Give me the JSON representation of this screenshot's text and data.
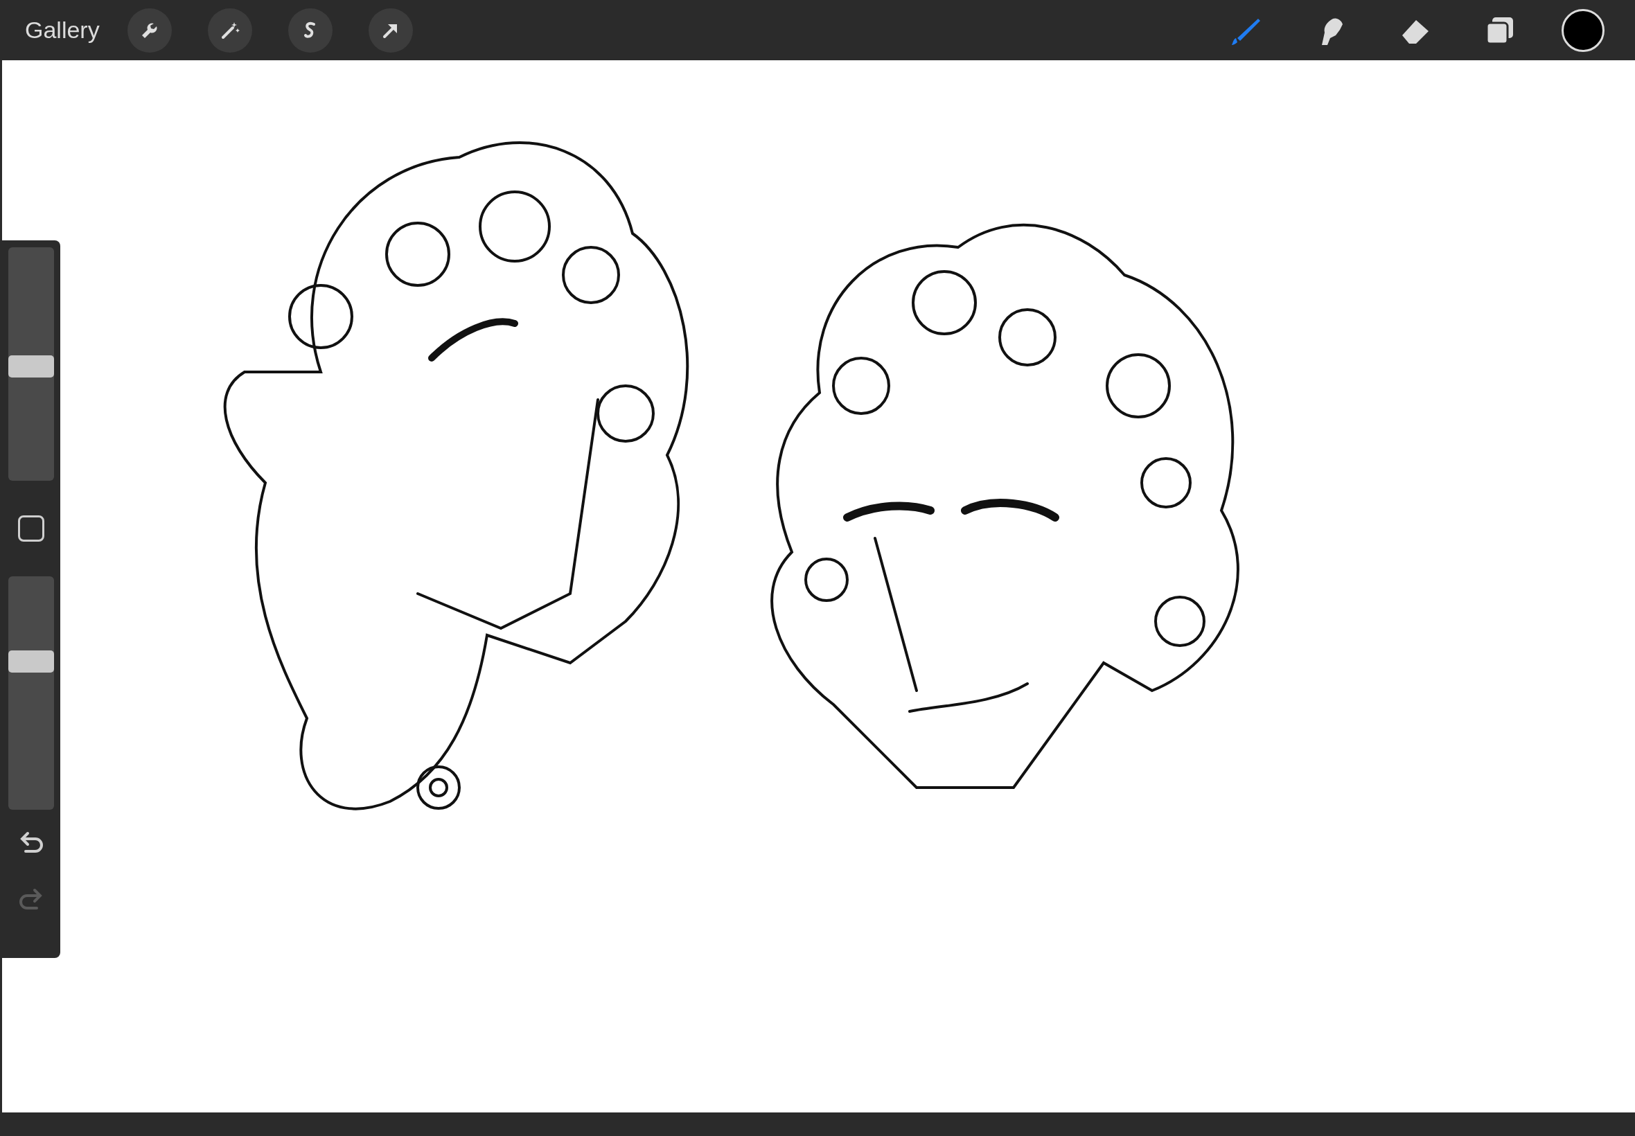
{
  "top_bar": {
    "gallery": "Gallery",
    "actions": [
      {
        "kind": "wrench"
      },
      {
        "kind": "wand"
      },
      {
        "kind": "selection"
      },
      {
        "kind": "transform"
      }
    ],
    "tools": [
      {
        "kind": "brush",
        "selected": true
      },
      {
        "kind": "smudge",
        "selected": false
      },
      {
        "kind": "eraser",
        "selected": false
      },
      {
        "kind": "layers",
        "selected": false
      }
    ],
    "color_swatch": {
      "color": "#000000"
    }
  },
  "sidebar": {
    "brush_size": {
      "level": 0.49
    },
    "opacity": {
      "level": 0.65
    },
    "redo_disabled": true
  }
}
